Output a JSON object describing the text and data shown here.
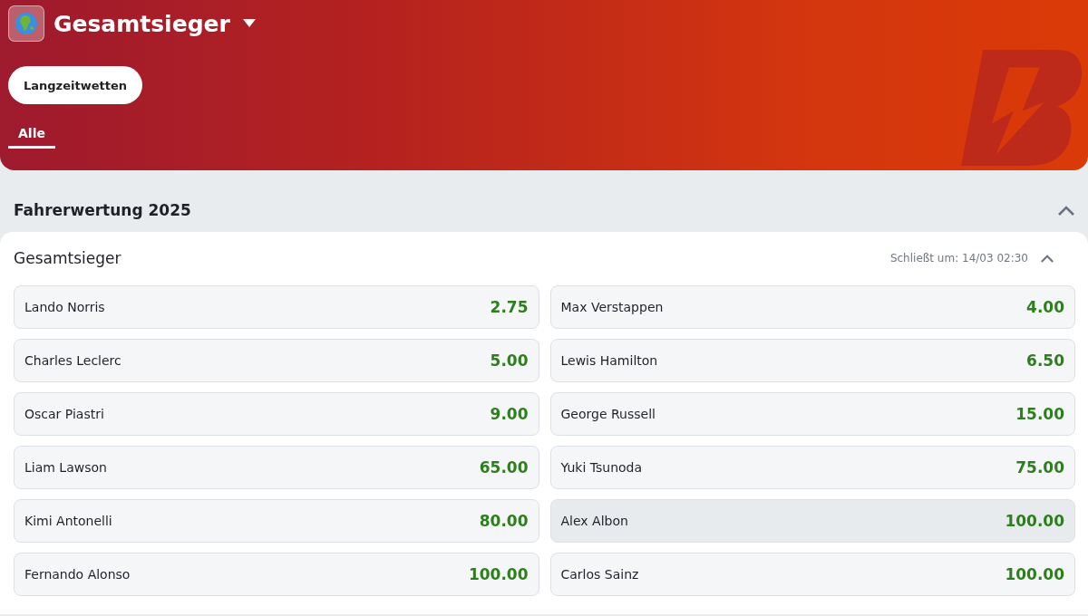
{
  "header": {
    "title": "Gesamtsieger",
    "pill": "Langzeitwetten",
    "tabs": [
      {
        "label": "Alle",
        "selected": true
      }
    ]
  },
  "section": {
    "title": "Fahrerwertung 2025",
    "expanded": true,
    "market": {
      "title": "Gesamtsieger",
      "closes": "Schließt um: 14/03 02:30",
      "expanded": true,
      "odds": [
        {
          "name": "Lando Norris",
          "price": "2.75",
          "highlighted": false
        },
        {
          "name": "Max Verstappen",
          "price": "4.00",
          "highlighted": false
        },
        {
          "name": "Charles Leclerc",
          "price": "5.00",
          "highlighted": false
        },
        {
          "name": "Lewis Hamilton",
          "price": "6.50",
          "highlighted": false
        },
        {
          "name": "Oscar Piastri",
          "price": "9.00",
          "highlighted": false
        },
        {
          "name": "George Russell",
          "price": "15.00",
          "highlighted": false
        },
        {
          "name": "Liam Lawson",
          "price": "65.00",
          "highlighted": false
        },
        {
          "name": "Yuki Tsunoda",
          "price": "75.00",
          "highlighted": false
        },
        {
          "name": "Kimi Antonelli",
          "price": "80.00",
          "highlighted": false
        },
        {
          "name": "Alex Albon",
          "price": "100.00",
          "highlighted": true
        },
        {
          "name": "Fernando Alonso",
          "price": "100.00",
          "highlighted": false
        },
        {
          "name": "Carlos Sainz",
          "price": "100.00",
          "highlighted": false
        }
      ]
    }
  }
}
